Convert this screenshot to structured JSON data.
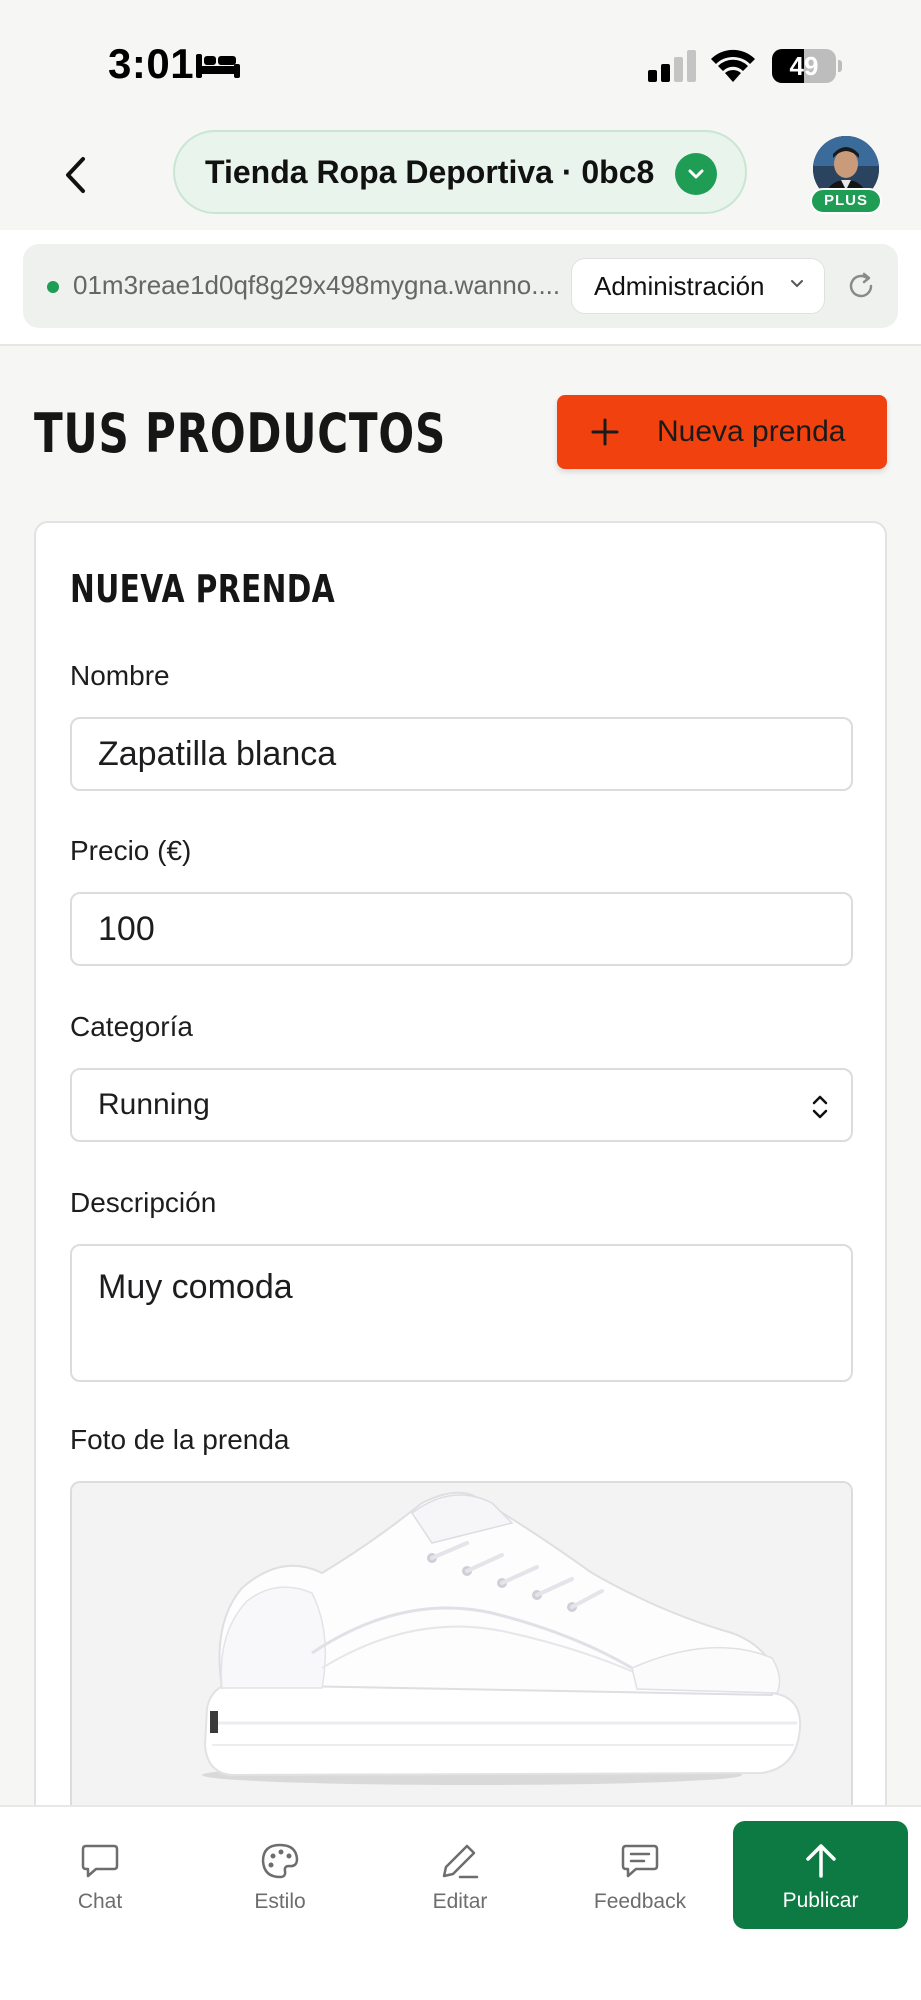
{
  "status_bar": {
    "time": "3:01",
    "battery": "49"
  },
  "header": {
    "project_name": "Tienda Ropa Deportiva · 0bc8",
    "plan_badge": "PLUS"
  },
  "url_bar": {
    "url": "01m3reae1d0qf8g29x498mygna.wanno....",
    "mode": "Administración"
  },
  "main": {
    "title": "TUS PRODUCTOS",
    "new_item_label": "Nueva prenda"
  },
  "form": {
    "title": "NUEVA PRENDA",
    "name_label": "Nombre",
    "name_value": "Zapatilla blanca",
    "price_label": "Precio (€)",
    "price_value": "100",
    "category_label": "Categoría",
    "category_value": "Running",
    "description_label": "Descripción",
    "description_value": "Muy comoda",
    "photo_label": "Foto de la prenda"
  },
  "tabs": [
    {
      "label": "Chat",
      "icon": "chat-icon"
    },
    {
      "label": "Estilo",
      "icon": "palette-icon"
    },
    {
      "label": "Editar",
      "icon": "pencil-icon"
    },
    {
      "label": "Feedback",
      "icon": "feedback-icon"
    }
  ],
  "publish": {
    "label": "Publicar",
    "icon": "arrow-up-icon"
  },
  "colors": {
    "accent_orange": "#f1410f",
    "brand_green": "#0d7a43",
    "status_green": "#1f9d55"
  }
}
